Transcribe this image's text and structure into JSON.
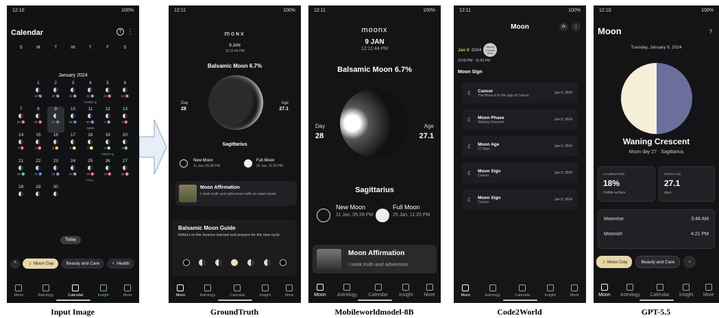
{
  "captions": [
    "Input Image",
    "GroundTruth",
    "Mobileworldmodel-8B",
    "Code2World",
    "GPT-5.5"
  ],
  "p1": {
    "time": "12:10",
    "battery": "100%",
    "title": "Calendar",
    "weekdays": [
      "S",
      "M",
      "T",
      "W",
      "T",
      "F",
      "S"
    ],
    "month": "January 2024",
    "rows": [
      [
        {
          "n": ""
        },
        {
          "n": ""
        },
        {
          "n": ""
        },
        {
          "n": ""
        },
        {
          "n": ""
        },
        {
          "n": ""
        },
        {
          "n": ""
        }
      ],
      [
        {
          "n": ""
        },
        {
          "n": "1",
          "s": "19 ♑"
        },
        {
          "n": "2",
          "s": "20 ♑"
        },
        {
          "n": "3",
          "s": "21 ♒"
        },
        {
          "n": "4",
          "s": "23 ♒"
        },
        {
          "n": "5",
          "s": "23 ♓"
        },
        {
          "n": "6",
          "s": "24 ♓"
        }
      ],
      [
        {
          "n": "7",
          "s": "25 ♈"
        },
        {
          "n": "8",
          "s": "26 ♈"
        },
        {
          "n": "9",
          "s": "27 ♐"
        },
        {
          "n": "10",
          "s": "28 ♐"
        },
        {
          "n": "11",
          "s": "30 ♑"
        },
        {
          "n": "12",
          "s": "1 ♒"
        },
        {
          "n": "13",
          "s": "2 ♓"
        }
      ],
      [
        {
          "n": "14",
          "s": "3 ♈"
        },
        {
          "n": "15",
          "s": "4 ♉"
        },
        {
          "n": "16",
          "s": "5 ♊"
        },
        {
          "n": "17",
          "s": "6 ♋"
        },
        {
          "n": "18",
          "s": "7 ♌"
        },
        {
          "n": "19",
          "s": "8 ♍"
        },
        {
          "n": "20",
          "s": "9 ♎"
        }
      ],
      [
        {
          "n": "21",
          "s": "10 ♏"
        },
        {
          "n": "22",
          "s": "11 ♐"
        },
        {
          "n": "23",
          "s": "12 ♑"
        },
        {
          "n": "24",
          "s": "13 ♒"
        },
        {
          "n": "25",
          "s": "15 ♓"
        },
        {
          "n": "26",
          "s": "15 ♈"
        },
        {
          "n": "27",
          "s": "16 ♉"
        }
      ],
      [
        {
          "n": "28",
          "s": ""
        },
        {
          "n": "29",
          "s": ""
        },
        {
          "n": "30",
          "s": ""
        },
        {
          "n": "",
          "s": ""
        },
        {
          "n": "",
          "s": ""
        },
        {
          "n": "",
          "s": ""
        },
        {
          "n": "",
          "s": ""
        }
      ]
    ],
    "third_q": "THIRD Q",
    "new": "NEW",
    "first_q": "FIRST Q",
    "full": "FULL",
    "today": "Today",
    "chips": [
      "Moon Day",
      "Beauty and Care",
      "Health"
    ],
    "nav": [
      "Moon",
      "Astrology",
      "Calendar",
      "Insight",
      "More"
    ]
  },
  "p2": {
    "time": "12:11",
    "battery": "100%",
    "brand": "mᴏɴx",
    "date": "9 JAN",
    "time2": "12:11:44 PM",
    "phase": "Balsamic Moon 6.7%",
    "day_l": "Day",
    "day_v": "28",
    "age_l": "Age",
    "age_v": "27.1",
    "sign": "Sagittarius",
    "new_t": "New Moon",
    "new_d": "11 Jan, 05:28 PM",
    "full_t": "Full Moon",
    "full_d": "25 Jan, 11:25 PM",
    "aff_t": "Moon Affirmation",
    "aff_d": "I seek truth and adventure with an open heart",
    "guide_t": "Balsamic Moon Guide",
    "guide_d": "Reflect on the lessons learned and prepare for the new cycle",
    "nav": [
      "Moon",
      "Astrology",
      "Calendar",
      "Insight",
      "More"
    ]
  },
  "p3": {
    "time": "12:11",
    "battery": "100%",
    "brand": "moonx",
    "date": "9 JAN",
    "time2": "12:11:44 PM",
    "phase": "Balsamic Moon 6.7%",
    "day_l": "Day",
    "day_v": "28",
    "age_l": "Age",
    "age_v": "27.1",
    "sign": "Sagittarius",
    "new_t": "New Moon",
    "new_d": "11 Jan, 05:28 PM",
    "full_t": "Full Moon",
    "full_d": "25 Jan, 11:25 PM",
    "aff_t": "Moon Affirmation",
    "aff_d": "I seek truth and adventure",
    "nav": [
      "Moon",
      "Astrology",
      "Calendar",
      "Insight",
      "More"
    ]
  },
  "p4": {
    "time": "12:11",
    "battery": "100%",
    "title": "Moon",
    "date": "Jan 9",
    "year": "2024",
    "badge": "Waning Crescent Moon",
    "hours": "10:00 PM - 11:00 PM",
    "section": "Moon Sign",
    "rows": [
      {
        "t": "Cancer",
        "s": "The Moon is in the sign of Cancer",
        "d": "Jan 9, 2024"
      },
      {
        "t": "Moon Phase",
        "s": "Waning Crescent",
        "d": "Jan 9, 2024"
      },
      {
        "t": "Moon Age",
        "s": "27 days",
        "d": "Jan 9, 2024"
      },
      {
        "t": "Moon Sign",
        "s": "Cancer",
        "d": "Jan 9, 2024"
      },
      {
        "t": "Moon Sign",
        "s": "Cancer",
        "d": "Jan 9, 2024"
      }
    ],
    "nav": [
      "Moon",
      "Astrology",
      "Calendar",
      "Insight",
      "More"
    ]
  },
  "p5": {
    "time": "12:10",
    "battery": "100%",
    "title": "Moon",
    "date": "Tuesday, January 9, 2024",
    "phase": "Waning Crescent",
    "sub": "Moon day 27 · Sagittarius",
    "ill_l": "ILLUMINATION",
    "ill_v": "18%",
    "ill_s": "Visible surface",
    "age_l": "MOON AGE",
    "age_v": "27.1",
    "age_s": "days",
    "moonrise_l": "Moonrise",
    "moonrise_v": "3:48 AM",
    "moonset_l": "Moonset",
    "moonset_v": "4:21 PM",
    "chips": [
      "Moon Day",
      "Beauty and Care"
    ],
    "nav": [
      "Moon",
      "Astrology",
      "Calendar",
      "Insight",
      "More"
    ]
  },
  "colors": {
    "bg": "#111214",
    "accent": "#e9d7a5",
    "purple": "#6a6f9c"
  }
}
